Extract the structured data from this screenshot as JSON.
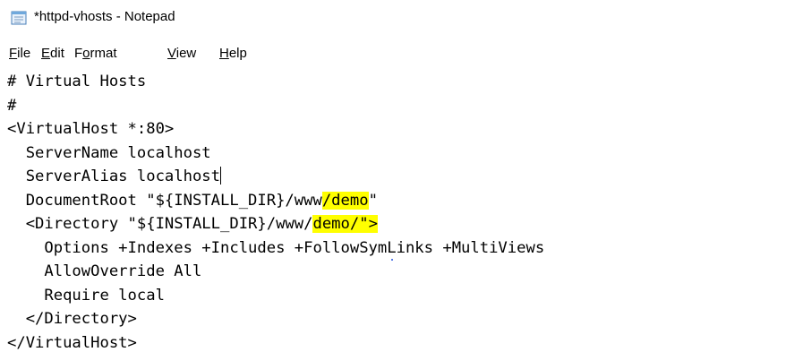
{
  "window": {
    "title": "*httpd-vhosts - Notepad",
    "app_icon": "notepad-icon"
  },
  "menu": [
    {
      "pre": "",
      "acc": "F",
      "post": "ile"
    },
    {
      "pre": "",
      "acc": "E",
      "post": "dit"
    },
    {
      "pre": "F",
      "acc": "o",
      "post": "rmat"
    },
    {
      "pre": "",
      "acc": "V",
      "post": "iew"
    },
    {
      "pre": "",
      "acc": "H",
      "post": "elp"
    }
  ],
  "editor": {
    "lines": {
      "l1": "# Virtual Hosts",
      "l2": "#",
      "l3": "<VirtualHost *:80>",
      "l4": "  ServerName localhost",
      "l5": "  ServerAlias localhost",
      "l6a": "  DocumentRoot \"${INSTALL_DIR}/www",
      "l6b": "/demo",
      "l6c": "\"",
      "l7a": "  <Directory \"${INSTALL_DIR}/www/",
      "l7b": "demo/\">",
      "l8": "    Options +Indexes +Includes +FollowSymLinks +MultiViews",
      "l9": "    AllowOverride All",
      "l10": "    Require local",
      "l11": "  </Directory>",
      "l12": "</VirtualHost>"
    },
    "highlight_color": "#ffff00"
  }
}
